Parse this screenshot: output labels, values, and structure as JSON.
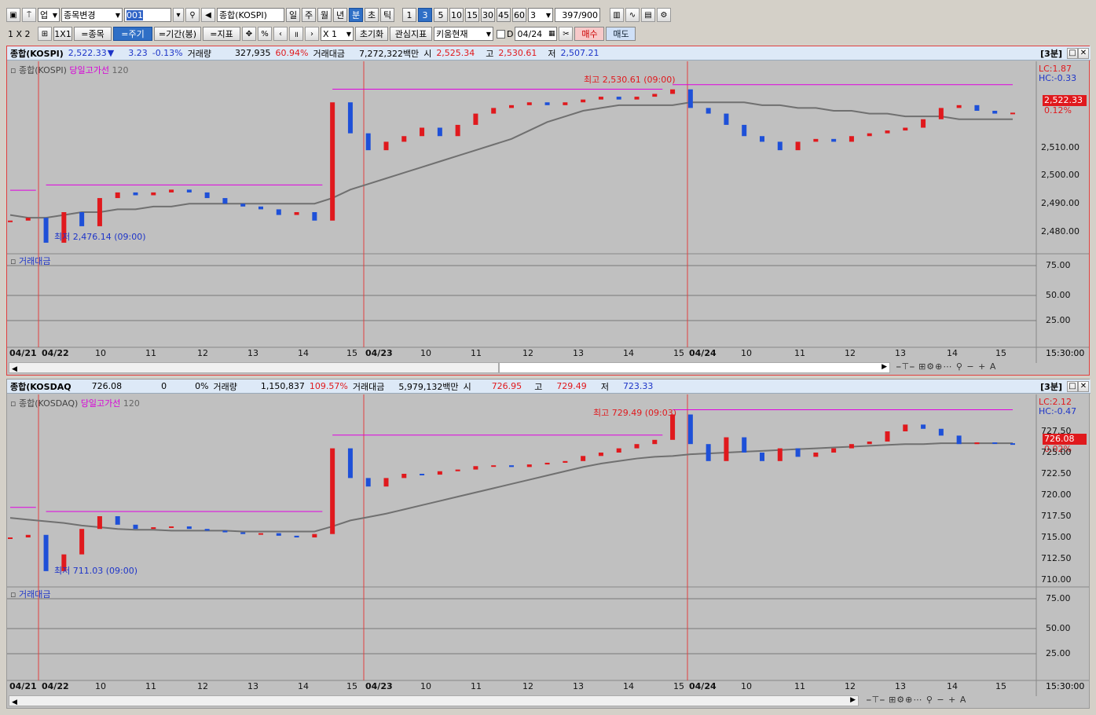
{
  "toolbar1": {
    "market": "업",
    "symbol_change": "종목변경",
    "code": "001",
    "name": "종합(KOSPI)",
    "periods": [
      "일",
      "주",
      "월",
      "년",
      "분",
      "초",
      "틱"
    ],
    "active_period": "분",
    "minutes": [
      "1",
      "3",
      "5",
      "10",
      "15",
      "30",
      "45",
      "60"
    ],
    "active_minute": "3",
    "interval_value": "3",
    "count": "397",
    "count_max": "/900"
  },
  "toolbar2": {
    "layout_label": "1 X 2",
    "layout_1x1": "1X1",
    "btn_symbol": "=종목",
    "btn_period": "=주기",
    "btn_range": "=기간(봉)",
    "btn_indicator": "=지표",
    "percent": "%",
    "multiplier": "X 1",
    "reset": "초기화",
    "interest": "관심지표",
    "kiwoom": "키움현재",
    "d_label": "D",
    "date": "04/24",
    "buy": "매수",
    "sell": "매도"
  },
  "kospi": {
    "name": "종합(KOSPI)",
    "price": "2,522.33",
    "arrow": "▼",
    "change": "3.23",
    "rate": "-0.13%",
    "vol_label": "거래량",
    "volume": "327,935",
    "vol_rate": "60.94%",
    "amt_label": "거래대금",
    "amount": "7,272,322백만",
    "open_label": "시",
    "open": "2,525.34",
    "high_label": "고",
    "high": "2,530.61",
    "low_label": "저",
    "low": "2,507.21",
    "period_badge": "[3분]",
    "legend_name": "종합(KOSPI)",
    "legend_line": "당일고가선",
    "legend_ma": "120",
    "lc": "LC:1.87",
    "hc": "HC:-0.33",
    "last_price_tag": "2,522.33",
    "last_pct": "0.12%",
    "max_annot": "최고 2,530.61 (09:00)",
    "min_annot": "최저 2,476.14 (09:00)",
    "y_ticks": [
      "2,510.00",
      "2,500.00",
      "2,490.00",
      "2,480.00"
    ],
    "sub_title": "거래대금",
    "sub_ticks": [
      "75.00",
      "50.00",
      "25.00"
    ]
  },
  "kosdaq": {
    "name": "종합(KOSDAQ",
    "price": "726.08",
    "change": "0",
    "rate": "0%",
    "vol_label": "거래량",
    "volume": "1,150,837",
    "vol_rate": "109.57%",
    "amt_label": "거래대금",
    "amount": "5,979,132백만",
    "open_label": "시",
    "open": "726.95",
    "high_label": "고",
    "high": "729.49",
    "low_label": "저",
    "low": "723.33",
    "period_badge": "[3분]",
    "legend_name": "종합(KOSDAQ)",
    "legend_line": "당일고가선",
    "legend_ma": "120",
    "lc": "LC:2.12",
    "hc": "HC:-0.47",
    "last_price_tag": "726.08",
    "last_pct": "0.02%",
    "max_annot": "최고 729.49 (09:03)",
    "min_annot": "최저 711.03 (09:00)",
    "y_ticks": [
      "727.50",
      "725.00",
      "722.50",
      "720.00",
      "717.50",
      "715.00",
      "712.50",
      "710.00"
    ],
    "sub_title": "거래대금",
    "sub_ticks": [
      "75.00",
      "50.00",
      "25.00"
    ]
  },
  "x_axis": [
    "04/21",
    "04/22",
    "10",
    "11",
    "12",
    "13",
    "14",
    "15",
    "04/23",
    "10",
    "11",
    "12",
    "13",
    "14",
    "15",
    "04/24",
    "10",
    "11",
    "12",
    "13",
    "14",
    "15"
  ],
  "time_label": "15:30:00",
  "colors": {
    "up": "#e0191d",
    "down": "#1e50d8",
    "ma": "#707070",
    "highline": "#e000e0",
    "bg": "#c0c0c0"
  },
  "chart_data": [
    {
      "type": "line",
      "title": "종합(KOSPI)",
      "series_note": "3-minute candles over 04/21–04/24 with 120-period moving average",
      "series": [
        {
          "name": "종합(KOSPI)",
          "values": [
            2484,
            2485,
            2476.14,
            2487,
            2482,
            2492,
            2494,
            2493,
            2494,
            2495,
            2494,
            2492,
            2490,
            2489,
            2488,
            2486,
            2487,
            2484,
            2526,
            2515,
            2509,
            2512,
            2514,
            2517,
            2514,
            2518,
            2522,
            2524,
            2525,
            2526,
            2525,
            2526,
            2527,
            2528,
            2527,
            2528,
            2529,
            2530.61,
            2524,
            2522,
            2518,
            2514,
            2512,
            2509,
            2512,
            2513,
            2512,
            2514,
            2515,
            2516,
            2517,
            2520,
            2524,
            2525,
            2523,
            2522,
            2522.33
          ]
        },
        {
          "name": "120",
          "values": [
            2486,
            2485,
            2485,
            2486,
            2487,
            2487,
            2488,
            2488,
            2489,
            2489,
            2490,
            2490,
            2490,
            2490,
            2490,
            2490,
            2490,
            2490,
            2492,
            2495,
            2497,
            2499,
            2501,
            2503,
            2505,
            2507,
            2509,
            2511,
            2513,
            2516,
            2519,
            2521,
            2523,
            2524,
            2525,
            2525,
            2525,
            2525,
            2526,
            2526,
            2526,
            2526,
            2525,
            2525,
            2524,
            2524,
            2523,
            2523,
            2522,
            2522,
            2521,
            2521,
            2521,
            2520,
            2520,
            2520,
            2520
          ]
        }
      ],
      "ylim": [
        2475,
        2535
      ]
    },
    {
      "type": "line",
      "title": "종합(KOSDAQ)",
      "series": [
        {
          "name": "종합(KOSDAQ)",
          "values": [
            715,
            715.3,
            711.03,
            713,
            716,
            717.5,
            716.5,
            716,
            716.2,
            716.3,
            716,
            715.8,
            715.6,
            715.4,
            715.5,
            715.2,
            715,
            715.4,
            725.5,
            722,
            721,
            722,
            722.5,
            722.4,
            722.8,
            723,
            723.4,
            723.5,
            723.3,
            723.6,
            723.8,
            724,
            724.6,
            725,
            725.5,
            726,
            726.5,
            729.49,
            726,
            724,
            726.8,
            725,
            724,
            725.5,
            724.5,
            725,
            725.5,
            726,
            726.3,
            727.5,
            728.3,
            727.8,
            727,
            726,
            726.2,
            726.1,
            726.08
          ]
        },
        {
          "name": "120",
          "values": [
            717.3,
            717.1,
            716.9,
            716.7,
            716.4,
            716.2,
            716,
            715.9,
            715.9,
            715.8,
            715.8,
            715.8,
            715.8,
            715.7,
            715.7,
            715.7,
            715.7,
            715.7,
            716.3,
            717,
            717.4,
            717.8,
            718.3,
            718.8,
            719.3,
            719.8,
            720.3,
            720.8,
            721.3,
            721.8,
            722.3,
            722.8,
            723.3,
            723.7,
            724,
            724.3,
            724.5,
            724.6,
            724.8,
            724.9,
            725,
            725.1,
            725.2,
            725.3,
            725.4,
            725.5,
            725.6,
            725.7,
            725.8,
            725.9,
            726,
            726,
            726.1,
            726.1,
            726.1,
            726.1,
            726.1
          ]
        }
      ],
      "ylim": [
        710,
        730
      ]
    }
  ]
}
